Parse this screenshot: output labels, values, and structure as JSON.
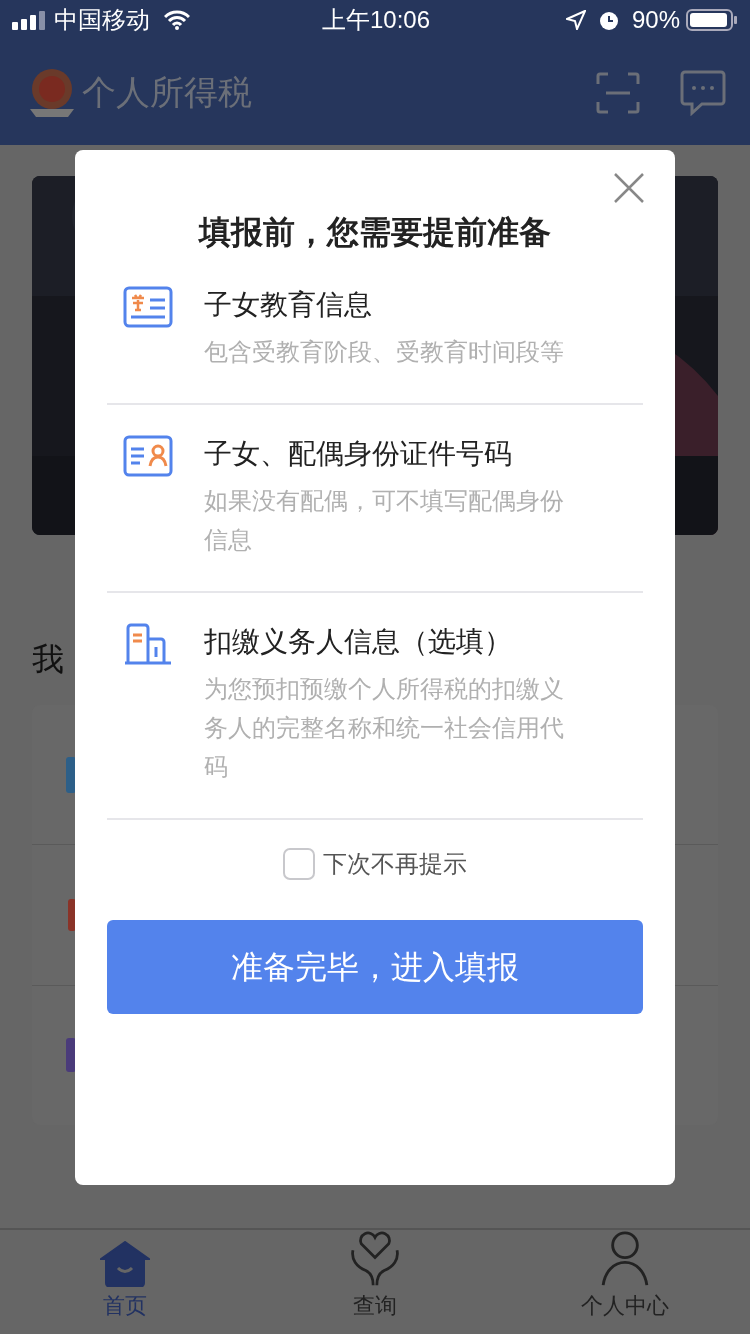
{
  "status_bar": {
    "carrier": "中国移动",
    "time": "上午10:06",
    "battery": "90%"
  },
  "header": {
    "title": "个人所得税"
  },
  "section": {
    "title_visible": "我"
  },
  "tabs": [
    {
      "label": "首页",
      "selected": true,
      "kind": "home"
    },
    {
      "label": "查询",
      "selected": false,
      "kind": "heart"
    },
    {
      "label": "个人中心",
      "selected": false,
      "kind": "person"
    }
  ],
  "dialog": {
    "title": "填报前，您需要提前准备",
    "items": [
      {
        "kind": "study",
        "title": "子女教育信息",
        "description": "包含受教育阶段、受教育时间段等"
      },
      {
        "kind": "id-card",
        "title": "子女、配偶身份证件号码",
        "description": "如果没有配偶，可不填写配偶身份信息"
      },
      {
        "kind": "building",
        "title": "扣缴义务人信息（选填）",
        "description": "为您预扣预缴个人所得税的扣缴义务人的完整名称和统一社会信用代码"
      }
    ],
    "checkbox": {
      "label": "下次不再提示",
      "checked": false
    },
    "button": "准备完毕，进入填报"
  }
}
